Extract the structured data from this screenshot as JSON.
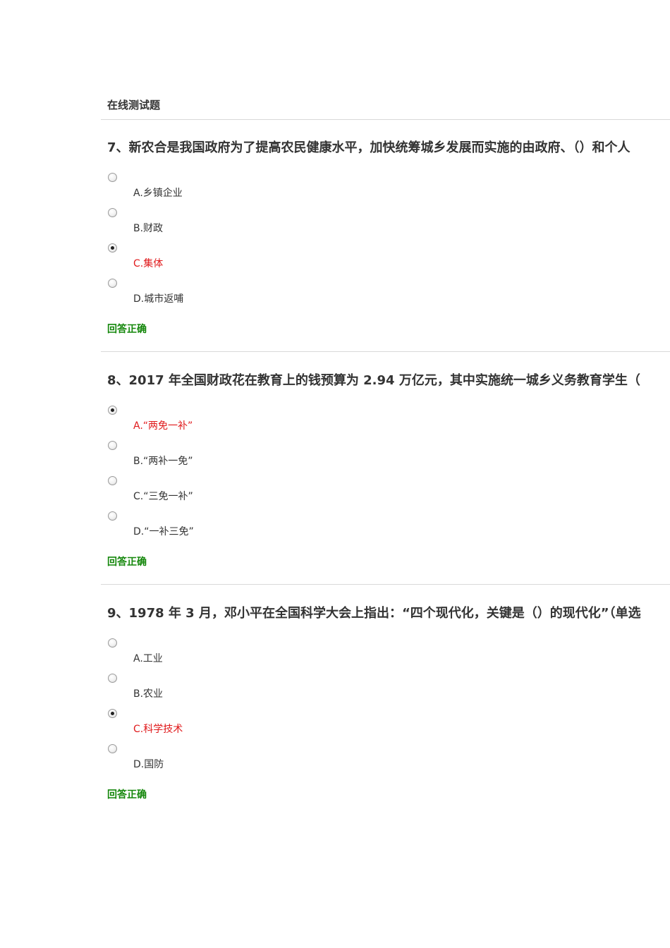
{
  "header": {
    "title": "在线测试题"
  },
  "questions": [
    {
      "title": "7、新农合是我国政府为了提高农民健康水平，加快统筹城乡发展而实施的由政府、（）和个人",
      "options": [
        {
          "label": "A.乡镇企业",
          "checked": false
        },
        {
          "label": "B.财政",
          "checked": false
        },
        {
          "label": "C.集体",
          "checked": true
        },
        {
          "label": "D.城市返哺",
          "checked": false
        }
      ],
      "result": "回答正确"
    },
    {
      "title": "8、2017 年全国财政花在教育上的钱预算为 2.94 万亿元，其中实施统一城乡义务教育学生（",
      "options": [
        {
          "label": "A.“两免一补”",
          "checked": true
        },
        {
          "label": "B.“两补一免”",
          "checked": false
        },
        {
          "label": "C.“三免一补”",
          "checked": false
        },
        {
          "label": "D.“一补三免”",
          "checked": false
        }
      ],
      "result": "回答正确"
    },
    {
      "title": "9、1978 年 3 月，邓小平在全国科学大会上指出：“四个现代化，关键是（）的现代化”（单选",
      "options": [
        {
          "label": "A.工业",
          "checked": false
        },
        {
          "label": "B.农业",
          "checked": false
        },
        {
          "label": "C.科学技术",
          "checked": true
        },
        {
          "label": "D.国防",
          "checked": false
        }
      ],
      "result": "回答正确"
    }
  ]
}
